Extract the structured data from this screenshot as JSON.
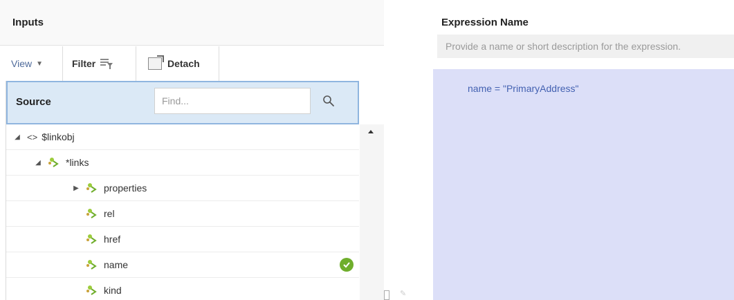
{
  "inputs": {
    "title": "Inputs",
    "toolbar": {
      "view_label": "View",
      "filter_label": "Filter",
      "detach_label": "Detach"
    }
  },
  "source": {
    "label": "Source",
    "find_placeholder": "Find...",
    "tree": [
      {
        "label": "$linkobj",
        "level": 0,
        "expanded": true,
        "icon": "angle-brackets-icon"
      },
      {
        "label": "*links",
        "level": 1,
        "expanded": true,
        "icon": "element-icon"
      },
      {
        "label": "properties",
        "level": 2,
        "expanded": false,
        "icon": "element-icon"
      },
      {
        "label": "rel",
        "level": 2,
        "icon": "element-icon"
      },
      {
        "label": "href",
        "level": 2,
        "icon": "element-icon"
      },
      {
        "label": "name",
        "level": 2,
        "icon": "element-icon",
        "checked": true
      },
      {
        "label": "kind",
        "level": 2,
        "icon": "element-icon"
      }
    ]
  },
  "expression": {
    "title": "Expression Name",
    "name_placeholder": "Provide a name or short description for the expression.",
    "text": "name = \"PrimaryAddress\""
  },
  "colors": {
    "accent_blue": "#4361b1",
    "source_header_bg": "#dbe9f6",
    "editor_bg": "#dcdff8",
    "check_green": "#6fae2c"
  }
}
